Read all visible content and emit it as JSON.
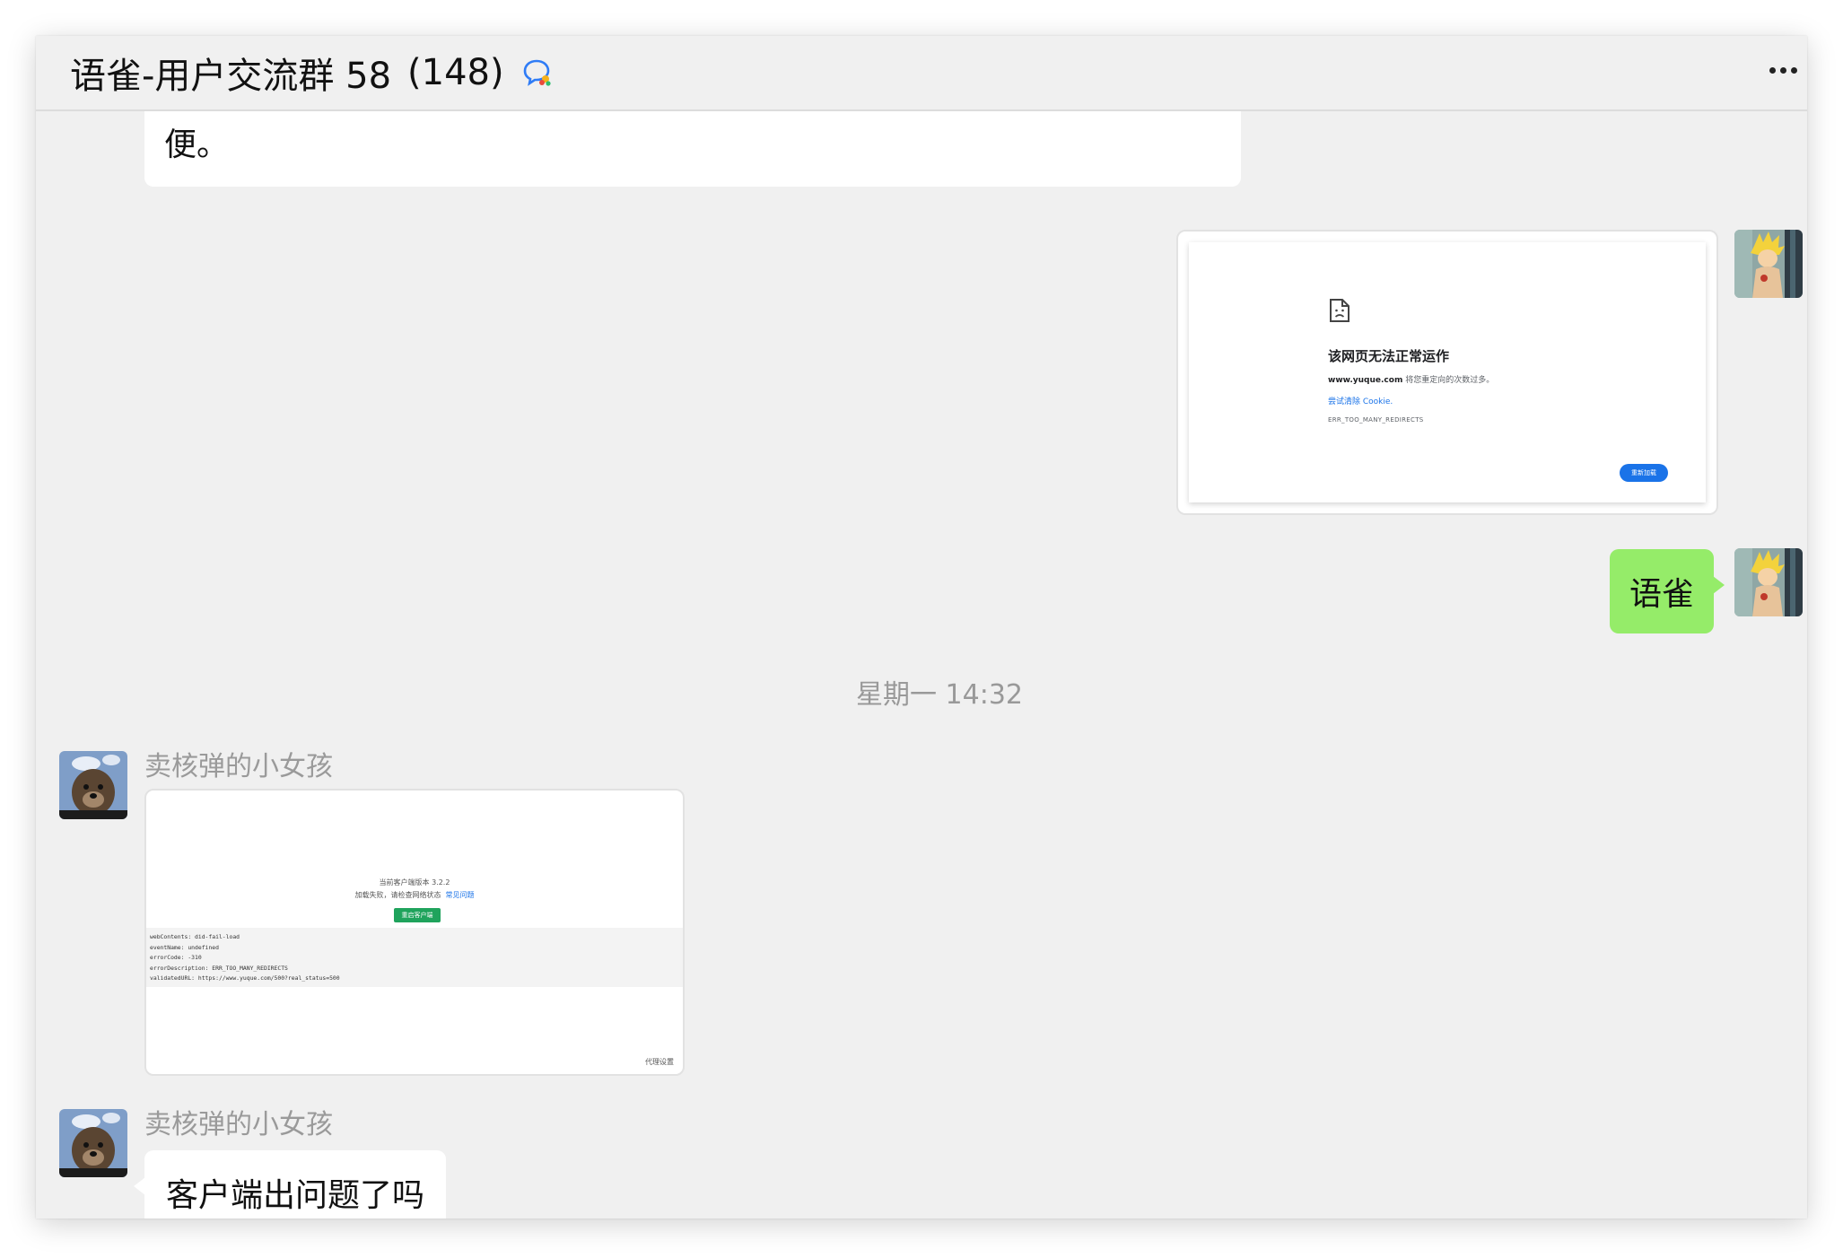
{
  "header": {
    "title": "语雀-用户交流群 58",
    "member_count": "(148)",
    "chat_icon": "group-chat-icon",
    "more_icon": "more-icon"
  },
  "messages": {
    "partial_text": "便。",
    "error_screenshot": {
      "title": "该网页无法正常运作",
      "domain": "www.yuque.com",
      "description": " 将您重定向的次数过多。",
      "link": "尝试清除 Cookie.",
      "code": "ERR_TOO_MANY_REDIRECTS",
      "reload_label": "重新加载"
    },
    "sent_text": "语雀",
    "timestamp": "星期一 14:32",
    "sender_name": "卖核弹的小女孩",
    "client_screenshot": {
      "version": "当前客户端版本 3.2.2",
      "status": "加载失败，请检查网络状态",
      "status_link": "常见问题",
      "restart_label": "重启客户端",
      "log_lines": [
        "webContents: did-fail-load",
        "eventName: undefined",
        "errorCode: -310",
        "errorDescription: ERR_TOO_MANY_REDIRECTS",
        "validatedURL: https://www.yuque.com/500?real_status=500"
      ],
      "proxy_label": "代理设置"
    },
    "sender_name_2": "卖核弹的小女孩",
    "question_text": "客户端出问题了吗"
  },
  "colors": {
    "sent_bubble": "#95ec69",
    "window_bg": "#f0f0f0",
    "link_blue": "#1a73e8",
    "restart_green": "#1fa35c"
  }
}
